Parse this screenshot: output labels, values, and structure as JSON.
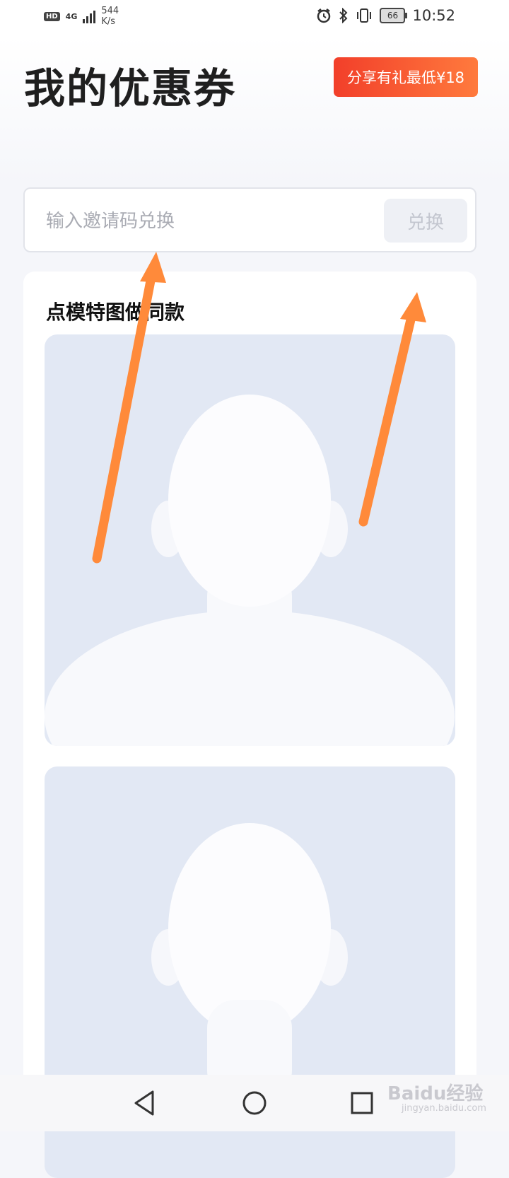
{
  "status_bar": {
    "hd": "HD",
    "network": "4G",
    "speed_value": "544",
    "speed_unit": "K/s",
    "battery": "66",
    "time": "10:52"
  },
  "header": {
    "title": "我的优惠券",
    "share_button_label": "分享有礼最低¥18"
  },
  "invite": {
    "placeholder": "输入邀请码兑换",
    "redeem_label": "兑换"
  },
  "section": {
    "title": "点模特图做同款"
  },
  "nav": {
    "back_icon": "triangle-back-icon",
    "home_icon": "circle-home-icon",
    "recents_icon": "square-recents-icon"
  },
  "watermark": {
    "brand": "Baidu经验",
    "sub": "jingyan.baidu.com"
  },
  "colors": {
    "share_gradient_start": "#f23f2a",
    "share_gradient_end": "#ff7a3d",
    "annotation_arrow": "#ff8a3a",
    "image_placeholder_bg": "#e2e8f4"
  }
}
